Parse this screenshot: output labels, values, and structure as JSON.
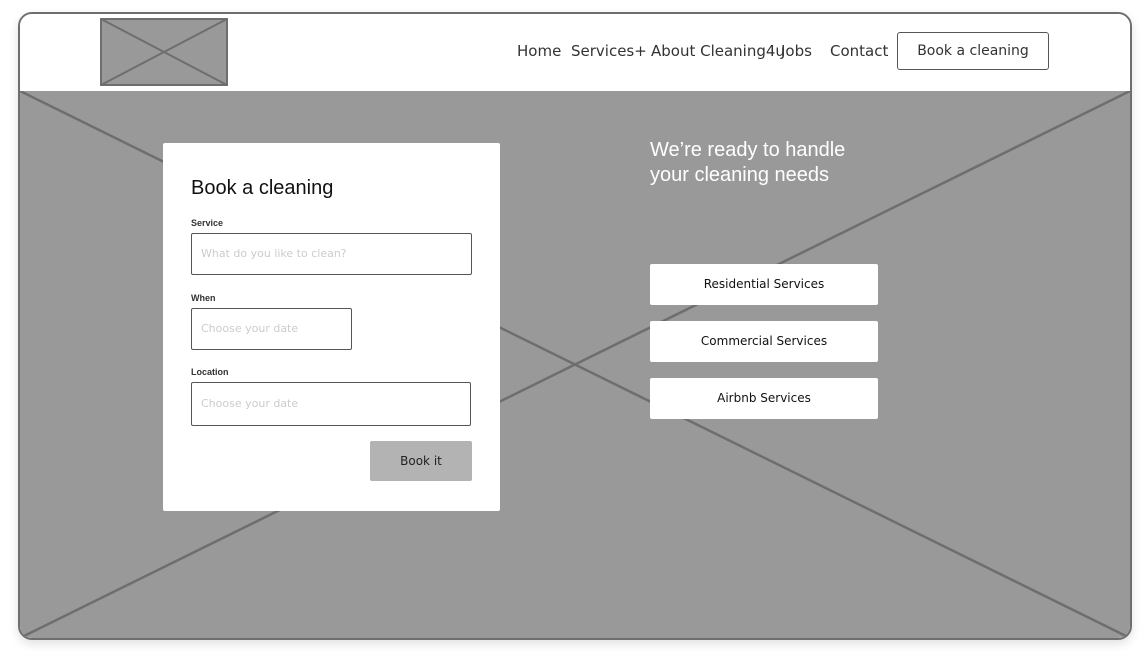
{
  "nav": {
    "items": [
      "Home",
      "Services",
      "About Cleaning4u",
      "Jobs",
      "Contact"
    ],
    "services_suffix": "+",
    "cta_label": "Book a cleaning"
  },
  "booking": {
    "title": "Book a cleaning",
    "service_label": "Service",
    "service_placeholder": "What do you like to clean?",
    "when_label": "When",
    "when_placeholder": "Choose your date",
    "location_label": "Location",
    "location_placeholder": "Choose your date",
    "submit_label": "Book it"
  },
  "hero": {
    "headline_line1": "We’re ready to handle",
    "headline_line2": "your cleaning needs",
    "services": [
      "Residential Services",
      "Commercial Services",
      "Airbnb Services"
    ]
  },
  "colors": {
    "placeholder_gray": "#999999",
    "button_gray": "#b3b3b3",
    "border": "#555555"
  }
}
